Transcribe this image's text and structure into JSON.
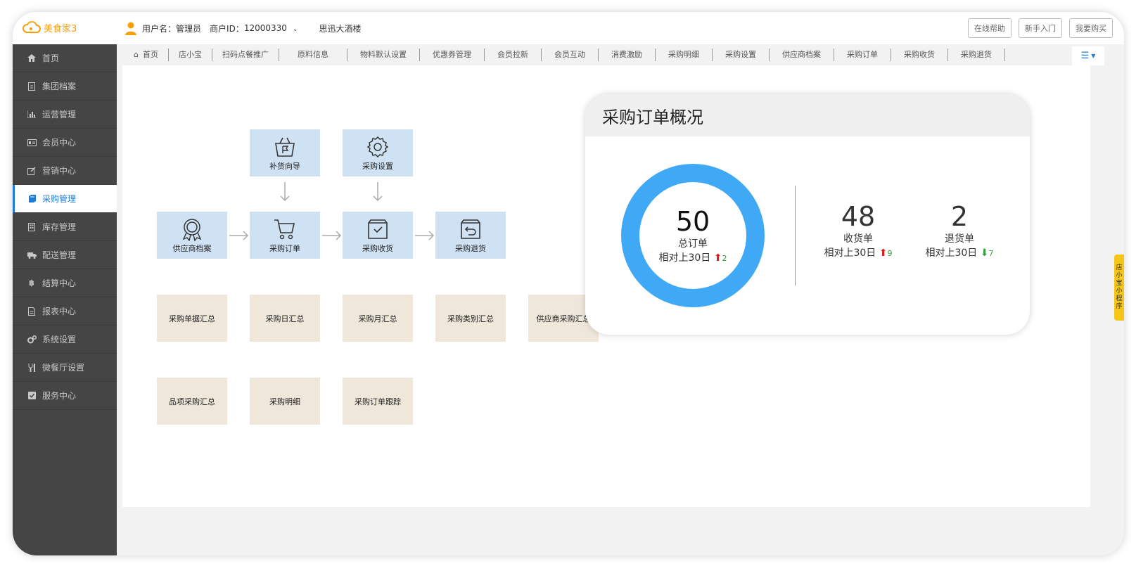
{
  "app": {
    "logo_text": "美食家3"
  },
  "user": {
    "username_label": "用户名：",
    "username": "管理员",
    "merchant_label": "商户ID：",
    "merchant_id": "12000330",
    "store": "思迅大酒楼"
  },
  "top_buttons": [
    "在线帮助",
    "新手入门",
    "我要购买"
  ],
  "sidebar": [
    {
      "label": "首页",
      "icon": "home-icon"
    },
    {
      "label": "集团档案",
      "icon": "file-icon"
    },
    {
      "label": "运营管理",
      "icon": "bar-chart-icon"
    },
    {
      "label": "会员中心",
      "icon": "id-card-icon"
    },
    {
      "label": "营销中心",
      "icon": "edit-icon"
    },
    {
      "label": "采购管理",
      "icon": "book-icon",
      "active": true
    },
    {
      "label": "库存管理",
      "icon": "building-icon"
    },
    {
      "label": "配送管理",
      "icon": "truck-icon"
    },
    {
      "label": "结算中心",
      "icon": "bitcoin-icon"
    },
    {
      "label": "报表中心",
      "icon": "report-icon"
    },
    {
      "label": "系统设置",
      "icon": "gears-icon"
    },
    {
      "label": "微餐厅设置",
      "icon": "cutlery-icon"
    },
    {
      "label": "服务中心",
      "icon": "check-square-icon"
    }
  ],
  "tabs": [
    "首页",
    "店小宝",
    "扫码点餐推广",
    "原料信息",
    "物料默认设置",
    "优惠券管理",
    "会员拉新",
    "会员互动",
    "消费激励",
    "采购明细",
    "采购设置",
    "供应商档案",
    "采购订单",
    "采购收货",
    "采购退货"
  ],
  "flow": {
    "replenish": "补货向导",
    "settings": "采购设置",
    "supplier": "供应商档案",
    "order": "采购订单",
    "receive": "采购收货",
    "return": "采购退货"
  },
  "reports_row1": [
    "采购单据汇总",
    "采购日汇总",
    "采购月汇总",
    "采购类别汇总",
    "供应商采购汇总"
  ],
  "reports_row2": [
    "品项采购汇总",
    "采购明细",
    "采购订单跟踪"
  ],
  "overview": {
    "title": "采购订单概况",
    "total": {
      "value": "50",
      "label": "总订单",
      "compare": "相对上30日",
      "delta": "2"
    },
    "received": {
      "value": "48",
      "label": "收货单",
      "compare": "相对上30日",
      "delta": "9"
    },
    "returned": {
      "value": "2",
      "label": "退货单",
      "compare": "相对上30日",
      "delta": "7"
    },
    "donut_color": "#3fa9f5"
  },
  "side_tag": [
    "店",
    "小",
    "宝",
    "小",
    "程",
    "序"
  ]
}
